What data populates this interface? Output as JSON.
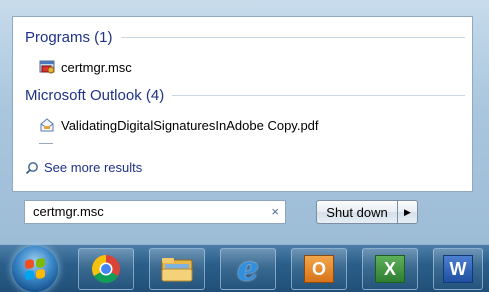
{
  "start_menu": {
    "groups": [
      {
        "header": "Programs (1)",
        "items": [
          {
            "label": "certmgr.msc",
            "icon": "certmgr-icon"
          }
        ]
      },
      {
        "header": "Microsoft Outlook (4)",
        "items": [
          {
            "label": "ValidatingDigitalSignaturesInAdobe Copy.pdf",
            "icon": "pdf-attachment-icon"
          }
        ]
      }
    ],
    "see_more": "See more results",
    "search": {
      "value": "certmgr.msc",
      "clear_glyph": "×"
    },
    "shutdown": {
      "label": "Shut down",
      "arrow_glyph": "▶"
    }
  },
  "taskbar": {
    "buttons": [
      {
        "name": "chrome",
        "icon": "chrome-icon"
      },
      {
        "name": "windows-explorer",
        "icon": "folder-icon"
      },
      {
        "name": "internet-explorer",
        "icon": "internet-explorer-icon",
        "glyph": "e"
      },
      {
        "name": "outlook",
        "icon": "outlook-icon",
        "glyph": "O"
      },
      {
        "name": "excel",
        "icon": "excel-icon",
        "glyph": "X"
      },
      {
        "name": "word",
        "icon": "word-icon",
        "glyph": "W"
      }
    ]
  },
  "colors": {
    "link_blue": "#1e3287",
    "taskbar": "#2b5f8a"
  }
}
